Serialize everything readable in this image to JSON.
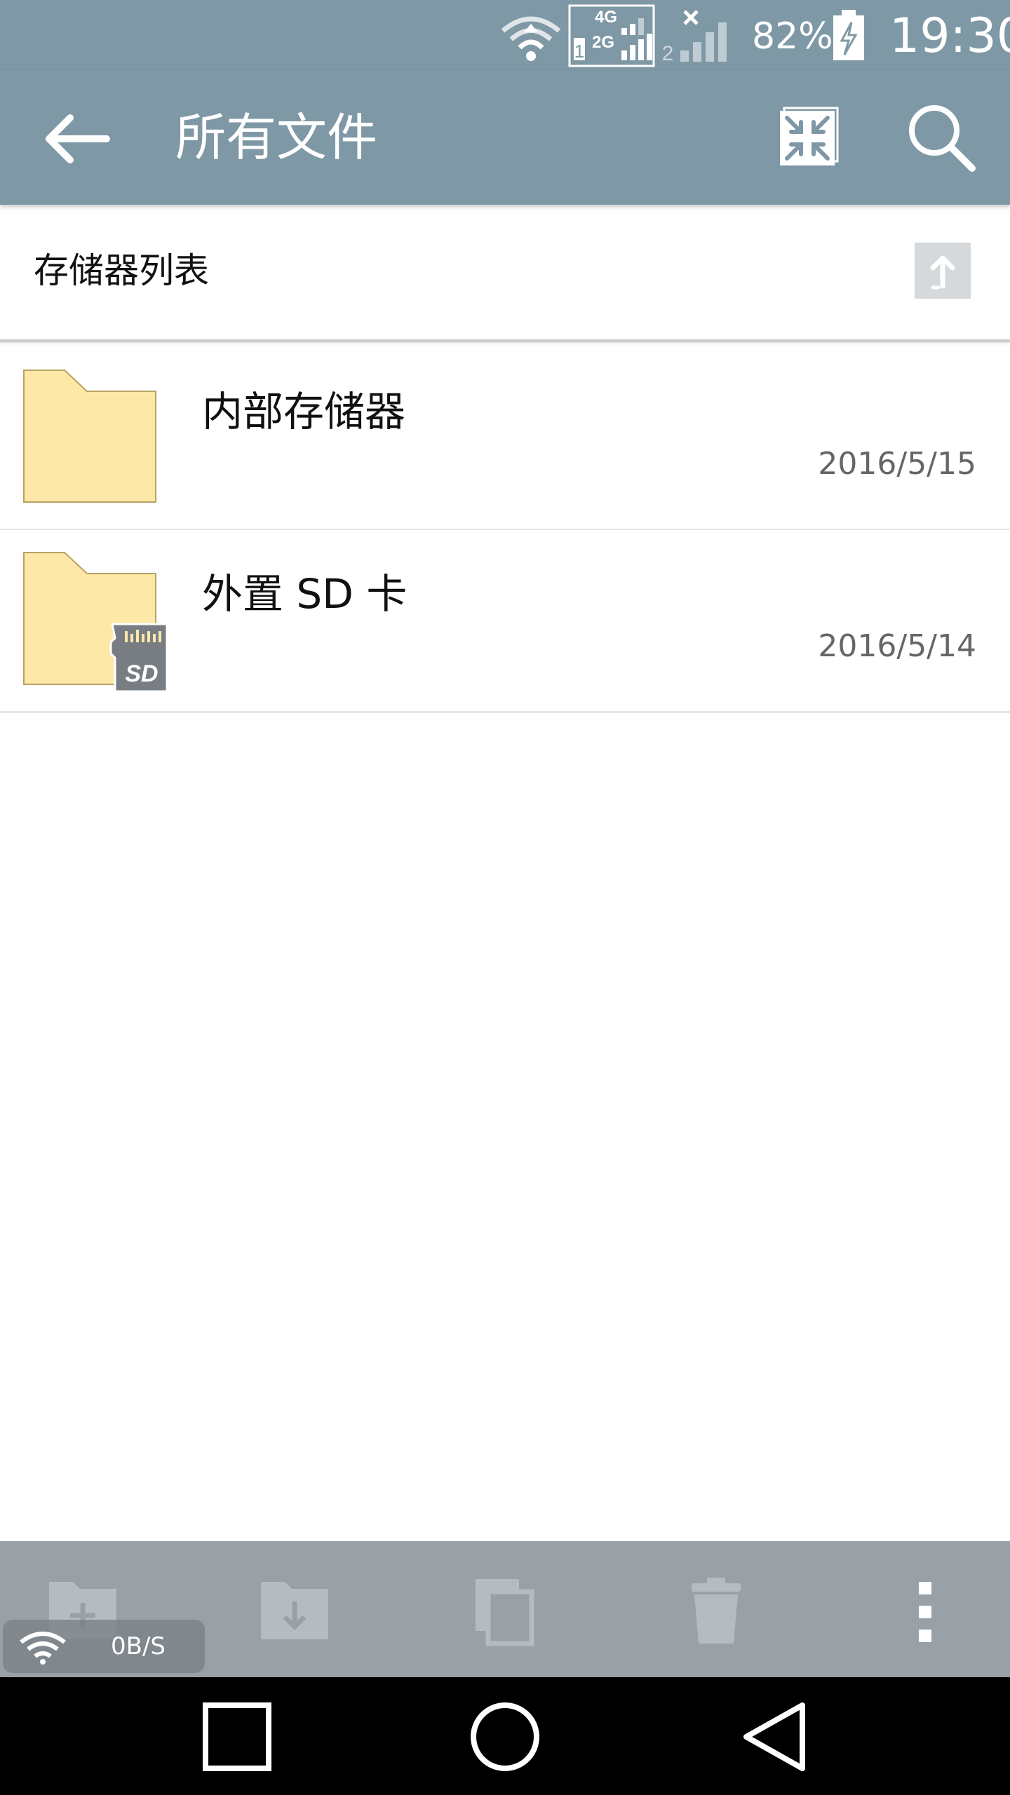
{
  "status_bar": {
    "battery_percent": "82%",
    "time": "19:30",
    "network_4g": "4G",
    "network_2g": "2G",
    "sim1_label": "1",
    "sim2_label": "2"
  },
  "toolbar": {
    "title": "所有文件"
  },
  "list_header": {
    "label": "存储器列表"
  },
  "files": [
    {
      "name": "内部存储器",
      "date": "2016/5/15",
      "icon": "folder-icon"
    },
    {
      "name": "外置 SD 卡",
      "date": "2016/5/14",
      "icon": "folder-sd-icon"
    }
  ],
  "network_overlay": {
    "speed": "0B/S"
  },
  "colors": {
    "accent": "#7f98a6",
    "folder": "#fde8a8",
    "action_bar": "#9aa1a6"
  }
}
